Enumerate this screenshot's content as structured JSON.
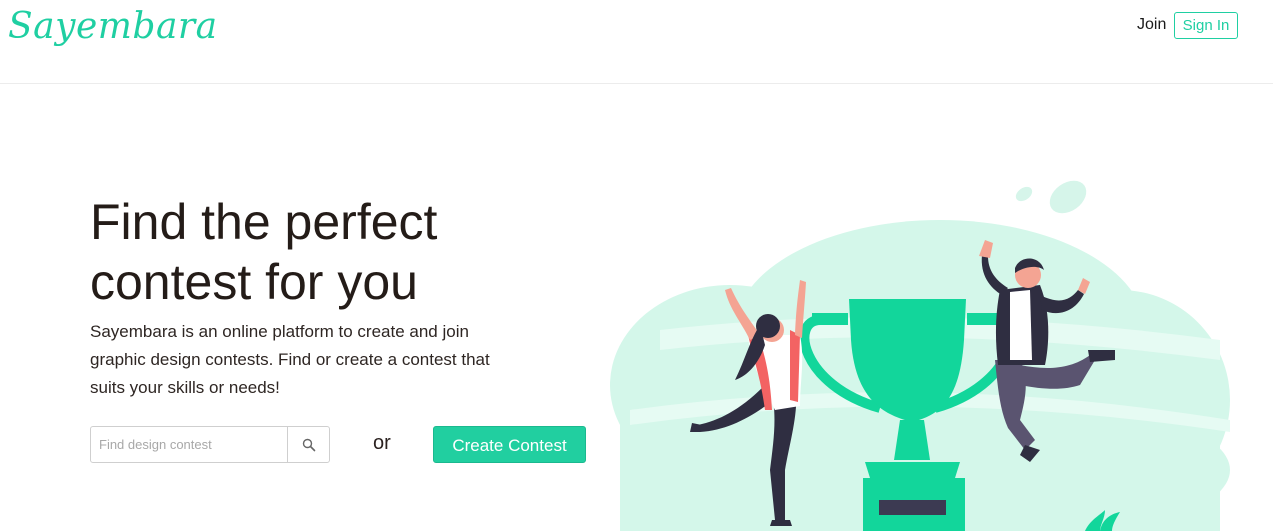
{
  "header": {
    "logo": "Sayembara",
    "join_label": "Join",
    "signin_label": "Sign In"
  },
  "hero": {
    "title_line1": "Find the perfect",
    "title_line2": "contest for you",
    "description": "Sayembara is an online platform to create and join graphic design contests. Find or create a contest that suits your skills or needs!",
    "search_placeholder": "Find design contest",
    "search_icon": "search-icon",
    "or_text": "or",
    "create_button_label": "Create Contest"
  },
  "colors": {
    "brand": "#1fcfa2",
    "button": "#21cfa0",
    "trophy": "#12d69b",
    "cloud": "#d4f7ea"
  }
}
